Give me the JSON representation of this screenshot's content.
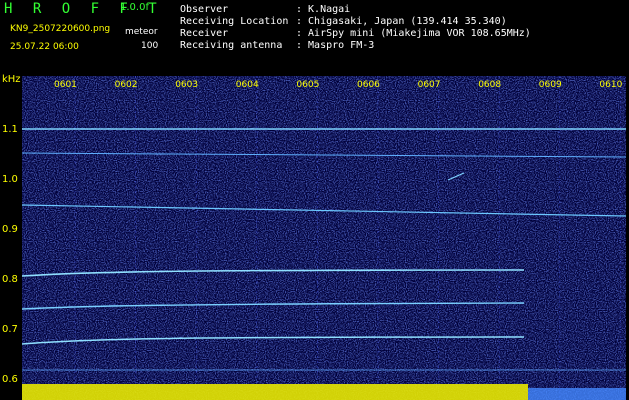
{
  "header": {
    "title": "H R O F F T",
    "version": "1.0.0f",
    "filename": "KN9_2507220600.png",
    "datetime": "25.07.22 06:00",
    "meteor_label": "meteor",
    "meteor_count": "100"
  },
  "info": [
    {
      "label": "Observer",
      "value": ": K.Nagai"
    },
    {
      "label": "Receiving Location",
      "value": ": Chigasaki, Japan (139.414 35.340)"
    },
    {
      "label": "Receiver",
      "value": ": AirSpy mini (Miakejima VOR 108.65MHz)"
    },
    {
      "label": "Receiving antenna",
      "value": ": Maspro FM-3"
    }
  ],
  "axes": {
    "y_unit": "kHz",
    "y_ticks": [
      "1.1",
      "1.0",
      "0.9",
      "0.8",
      "0.7",
      "0.6"
    ],
    "x_ticks": [
      "0601",
      "0602",
      "0603",
      "0604",
      "0605",
      "0606",
      "0607",
      "0608",
      "0609",
      "0610"
    ]
  },
  "colors": {
    "background": "#000000",
    "noise": "#1a2a8a",
    "trace": "#6cc8ff",
    "label": "#ffff00"
  }
}
